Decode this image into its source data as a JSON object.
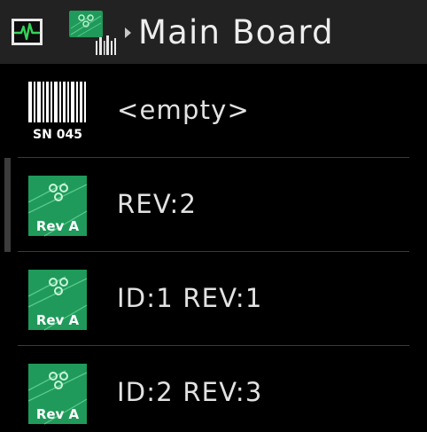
{
  "header": {
    "status_icon": "heart-monitor-icon",
    "board_icon": "circuit-board-icon",
    "chevron_icon": "chevron-right-icon",
    "title": "Main Board"
  },
  "colors": {
    "background": "#000000",
    "header_background": "#222222",
    "board_green": "#1f9a5a",
    "text": "#e6e6e6",
    "divider": "#3a3a3a"
  },
  "list": {
    "items": [
      {
        "icon": "barcode-icon",
        "icon_caption": "SN 045",
        "label": "<empty>"
      },
      {
        "icon": "circuit-board-rev-icon",
        "icon_caption": "Rev A",
        "label": "REV:2"
      },
      {
        "icon": "circuit-board-rev-icon",
        "icon_caption": "Rev A",
        "label": "ID:1 REV:1"
      },
      {
        "icon": "circuit-board-rev-icon",
        "icon_caption": "Rev A",
        "label": "ID:2 REV:3"
      }
    ]
  }
}
